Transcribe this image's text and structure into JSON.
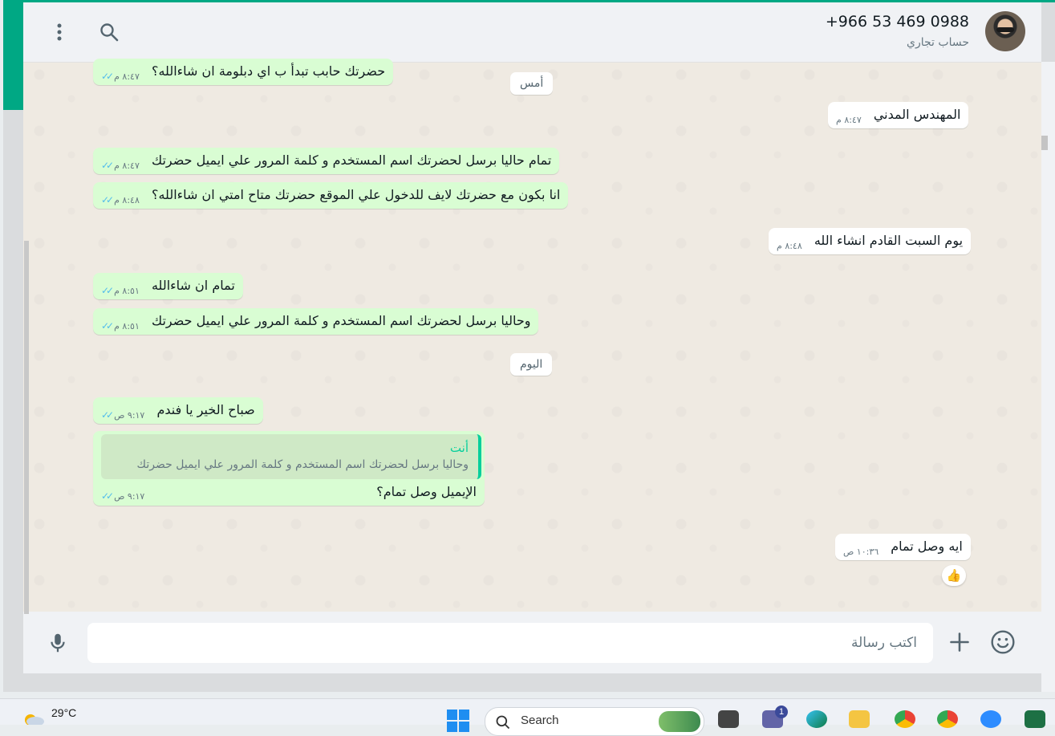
{
  "contact": {
    "name": "+966 53 469 0988",
    "subtitle": "حساب تجاري"
  },
  "dates": {
    "yesterday": "أمس",
    "today": "اليوم"
  },
  "messages": [
    {
      "dir": "out",
      "text": "حضرتك حابب تبدأ ب اي دبلومة ان شاءالله؟",
      "time": "٨:٤٧ م"
    },
    {
      "dir": "in",
      "text": "المهندس المدني",
      "time": "٨:٤٧ م"
    },
    {
      "dir": "out",
      "text": "تمام حاليا برسل لحضرتك اسم المستخدم و كلمة المرور علي ايميل حضرتك",
      "time": "٨:٤٧ م"
    },
    {
      "dir": "out",
      "text": "انا بكون مع حضرتك لايف للدخول علي الموقع حضرتك متاح امتي ان شاءالله؟",
      "time": "٨:٤٨ م"
    },
    {
      "dir": "in",
      "text": "يوم السبت القادم انشاء الله",
      "time": "٨:٤٨ م"
    },
    {
      "dir": "out",
      "text": "تمام ان شاءالله",
      "time": "٨:٥١ م"
    },
    {
      "dir": "out",
      "text": "وحاليا برسل لحضرتك اسم المستخدم و كلمة المرور علي ايميل حضرتك",
      "time": "٨:٥١ م"
    },
    {
      "dir": "out",
      "text": "صباح الخير يا فندم",
      "time": "٩:١٧ ص"
    },
    {
      "dir": "out",
      "text": "الإيميل وصل تمام؟",
      "time": "٩:١٧ ص",
      "quote_author": "أنت",
      "quote_text": "وحاليا برسل لحضرتك اسم المستخدم و كلمة المرور علي ايميل حضرتك"
    },
    {
      "dir": "in",
      "text": "ايه وصل تمام",
      "time": "١٠:٣٦ ص",
      "reaction": "👍"
    }
  ],
  "composer": {
    "placeholder": "اكتب رسالة"
  },
  "taskbar": {
    "temperature": "29°C",
    "search_label": "Search",
    "notification_count": "1"
  },
  "colors": {
    "accent": "#00a884",
    "outgoing_bubble": "#d9fdd3",
    "incoming_bubble": "#ffffff",
    "read_ticks": "#53bdeb",
    "chat_bg": "#efeae2"
  },
  "icons": [
    "menu-icon",
    "search-icon",
    "mic-icon",
    "plus-icon",
    "emoji-icon",
    "double-check-icon"
  ]
}
